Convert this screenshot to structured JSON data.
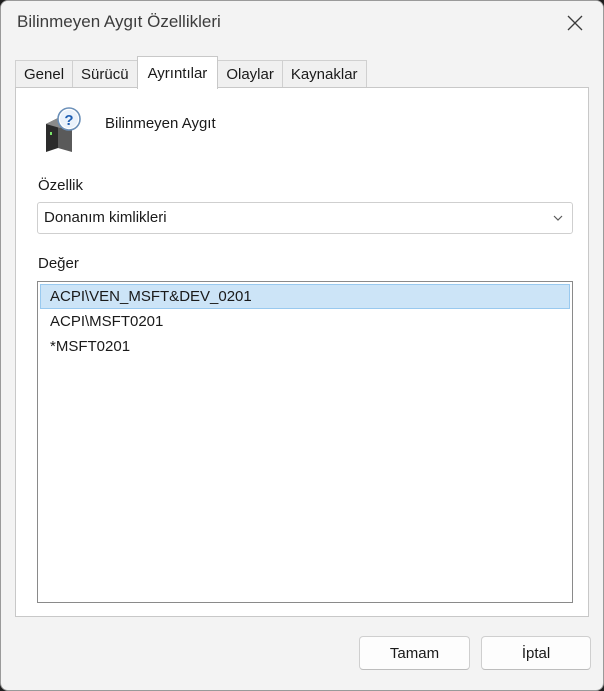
{
  "window": {
    "title": "Bilinmeyen Aygıt Özellikleri"
  },
  "tabs": [
    {
      "label": "Genel",
      "active": false
    },
    {
      "label": "Sürücü",
      "active": false
    },
    {
      "label": "Ayrıntılar",
      "active": true
    },
    {
      "label": "Olaylar",
      "active": false
    },
    {
      "label": "Kaynaklar",
      "active": false
    }
  ],
  "device": {
    "name": "Bilinmeyen Aygıt",
    "icon": "unknown-device-icon"
  },
  "property": {
    "label": "Özellik",
    "selected": "Donanım kimlikleri"
  },
  "value": {
    "label": "Değer",
    "items": [
      {
        "text": "ACPI\\VEN_MSFT&DEV_0201",
        "selected": true
      },
      {
        "text": "ACPI\\MSFT0201",
        "selected": false
      },
      {
        "text": "*MSFT0201",
        "selected": false
      }
    ]
  },
  "buttons": {
    "ok": "Tamam",
    "cancel": "İptal"
  },
  "colors": {
    "selection": "#cce4f7",
    "selection_border": "#99c9ef",
    "background": "#f3f3f3"
  }
}
